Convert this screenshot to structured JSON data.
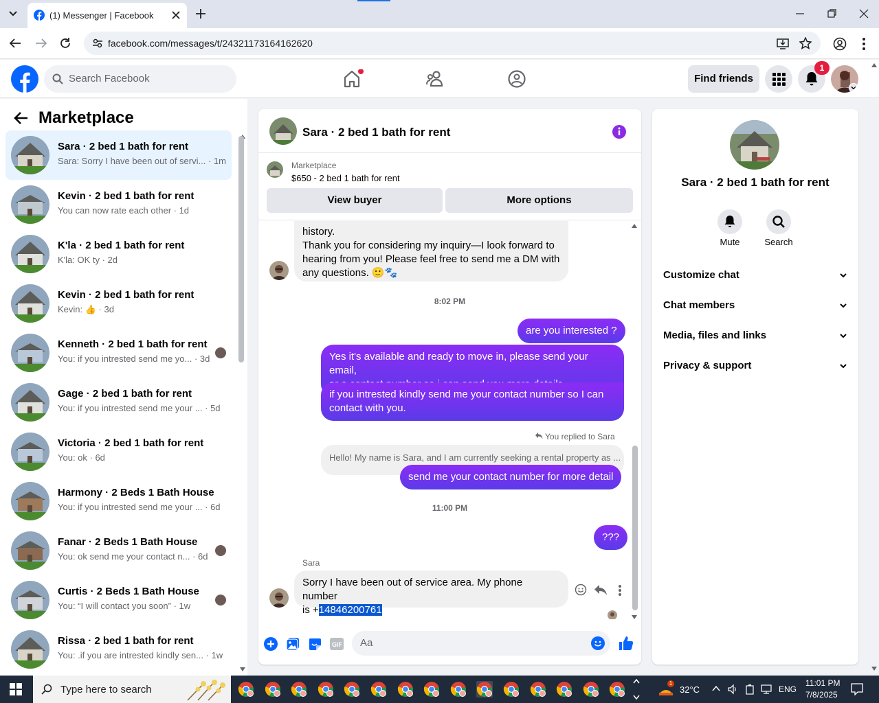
{
  "browser": {
    "tab_title": "(1) Messenger | Facebook",
    "url": "facebook.com/messages/t/24321173164162620"
  },
  "fb": {
    "search_placeholder": "Search Facebook",
    "find_friends": "Find friends",
    "notifications_count": "1"
  },
  "left": {
    "header": "Marketplace",
    "conversations": [
      {
        "name": "Sara · 2 bed 1 bath for rent",
        "snippet": "Sara: Sorry I have been out of servi... · 1m",
        "active": true
      },
      {
        "name": "Kevin · 2 bed 1 bath for rent",
        "snippet": "You can now rate each other · 1d"
      },
      {
        "name": "K'la · 2 bed 1 bath for rent",
        "snippet": "K'la: OK ty · 2d"
      },
      {
        "name": "Kevin · 2 bed 1 bath for rent",
        "snippet": "Kevin: 👍 · 3d"
      },
      {
        "name": "Kenneth · 2 bed 1 bath for rent",
        "snippet": "You: if you intrested send me yo... · 3d"
      },
      {
        "name": "Gage · 2 bed 1 bath for rent",
        "snippet": "You: if you intrested send me your ... · 5d"
      },
      {
        "name": "Victoria · 2 bed 1 bath for rent",
        "snippet": "You: ok · 6d"
      },
      {
        "name": "Harmony · 2 Beds 1 Bath House",
        "snippet": "You: if you intrested send me your ... · 6d"
      },
      {
        "name": "Fanar · 2 Beds 1 Bath House",
        "snippet": "You: ok send me your contact n... · 6d"
      },
      {
        "name": "Curtis · 2 Beds 1 Bath House",
        "snippet": "You: “I will contact you soon” · 1w"
      },
      {
        "name": "Rissa · 2 bed 1 bath for rent",
        "snippet": "You: .if you are intrested kindly sen... · 1w"
      }
    ]
  },
  "chat": {
    "title": "Sara · 2 bed 1 bath for rent",
    "marketplace_label": "Marketplace",
    "listing": "$650 - 2 bed 1 bath for rent",
    "view_buyer": "View buyer",
    "more_options": "More options",
    "msg1_line1": "history.",
    "msg1_line2": "Thank you for considering my inquiry—I look forward to",
    "msg1_line3": "hearing from you! Please feel free to send me a DM with",
    "msg1_line4": "any questions. 🙂🐾",
    "time1": "8:02 PM",
    "out1": "are you interested ?",
    "out2_line1": "Yes it's available and ready to move in, please send your email,",
    "out2_line2": "or a contact number so i can send you more details.",
    "out3_line1": "if you intrested  kindly send me your contact number so I can",
    "out3_line2": "contact with you.",
    "replied": "You replied to Sara",
    "quoted": "Hello! My name is Sara, and I am currently seeking a rental property as ...",
    "out4": "send me your contact number for more detail",
    "time2": "11:00 PM",
    "out5": "???",
    "sender": "Sara",
    "last_line1": "Sorry I have been out of service area. My phone number",
    "last_line2_prefix": "is +",
    "last_phone": "14846200761",
    "composer_placeholder": "Aa"
  },
  "info": {
    "name": "Sara · 2 bed 1 bath for rent",
    "mute": "Mute",
    "search": "Search",
    "sections": [
      "Customize chat",
      "Chat members",
      "Media, files and links",
      "Privacy & support"
    ]
  },
  "taskbar": {
    "search_placeholder": "Type here to search",
    "temp": "32°C",
    "lang": "ENG",
    "time": "11:01 PM",
    "date": "7/8/2025",
    "weather_badge": "1"
  },
  "colors": {
    "fb_blue": "#0866ff",
    "bubble_out": "#7b2cf0",
    "bubble_in": "#f0f0f0"
  }
}
